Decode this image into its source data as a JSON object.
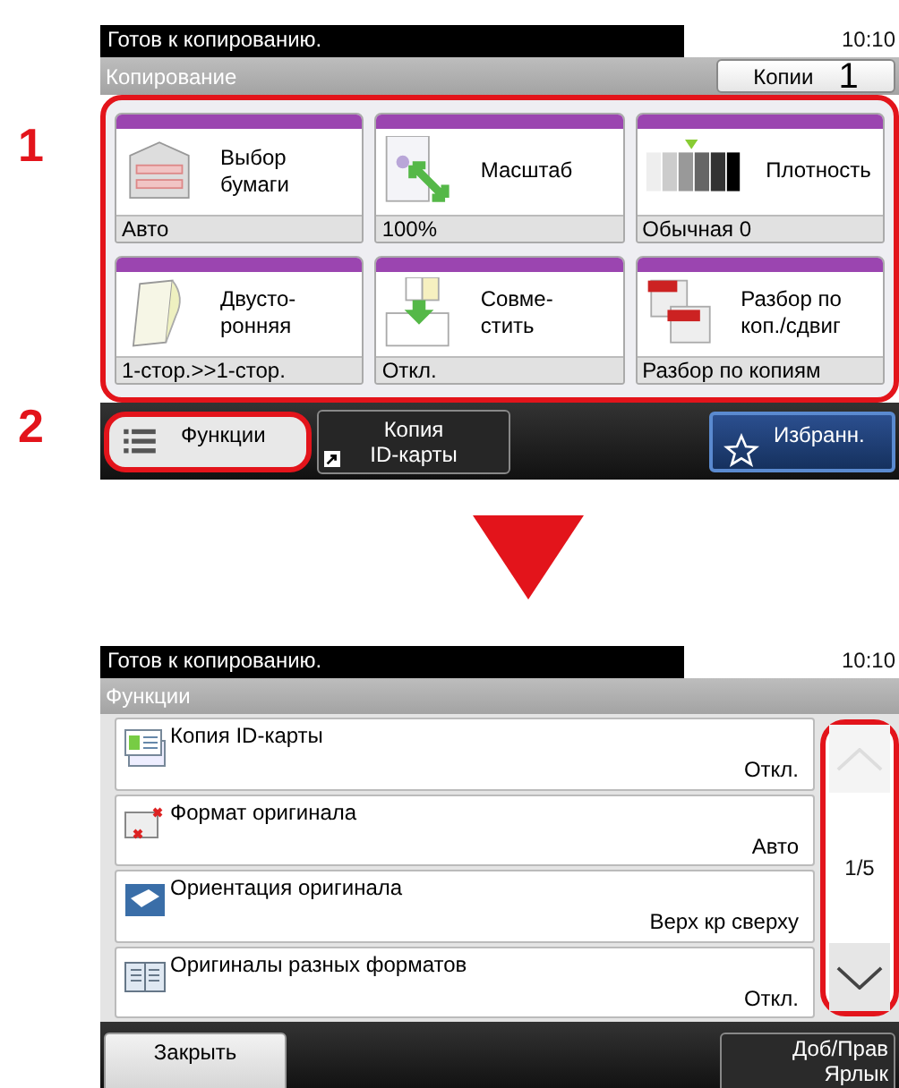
{
  "callouts": [
    {
      "label": "1"
    },
    {
      "label": "2"
    }
  ],
  "copy_screen": {
    "status": "Готов к копированию.",
    "time": "10:10",
    "title": "Копирование",
    "copies_label": "Копии",
    "copies_value": "1",
    "tiles_highlighted": true,
    "tiles": [
      {
        "kind": "paper",
        "label": "Выбор бумаги",
        "value": "Авто"
      },
      {
        "kind": "zoom",
        "label": "Масштаб",
        "value": "100%"
      },
      {
        "kind": "density",
        "label": "Плотность",
        "value": "Обычная 0"
      },
      {
        "kind": "duplex",
        "label": "Двусто-ронняя",
        "value": "1-стор.>>1-стор."
      },
      {
        "kind": "combine",
        "label": "Совме-стить",
        "value": "Откл."
      },
      {
        "kind": "collate",
        "label": "Разбор по коп./сдвиг",
        "value": "Разбор по копиям"
      }
    ],
    "functions_button": {
      "label": "Функции",
      "highlighted": true
    },
    "id_copy_button": {
      "label": "Копия ID-карты"
    },
    "favorites_button": {
      "label": "Избранн."
    }
  },
  "functions_screen": {
    "status": "Готов к копированию.",
    "time": "10:10",
    "title": "Функции",
    "items": [
      {
        "kind": "idcard",
        "name": "Копия ID-карты",
        "value": "Откл."
      },
      {
        "kind": "format",
        "name": "Формат оригинала",
        "value": "Авто"
      },
      {
        "kind": "orientation",
        "name": "Ориентация оригинала",
        "value": "Верх кр сверху"
      },
      {
        "kind": "mixed",
        "name": "Оригиналы разных форматов",
        "value": "Откл."
      }
    ],
    "page": "1/5",
    "scroll_highlighted": true,
    "close_button": "Закрыть",
    "shortcut_button": "Доб/Прав Ярлык"
  }
}
